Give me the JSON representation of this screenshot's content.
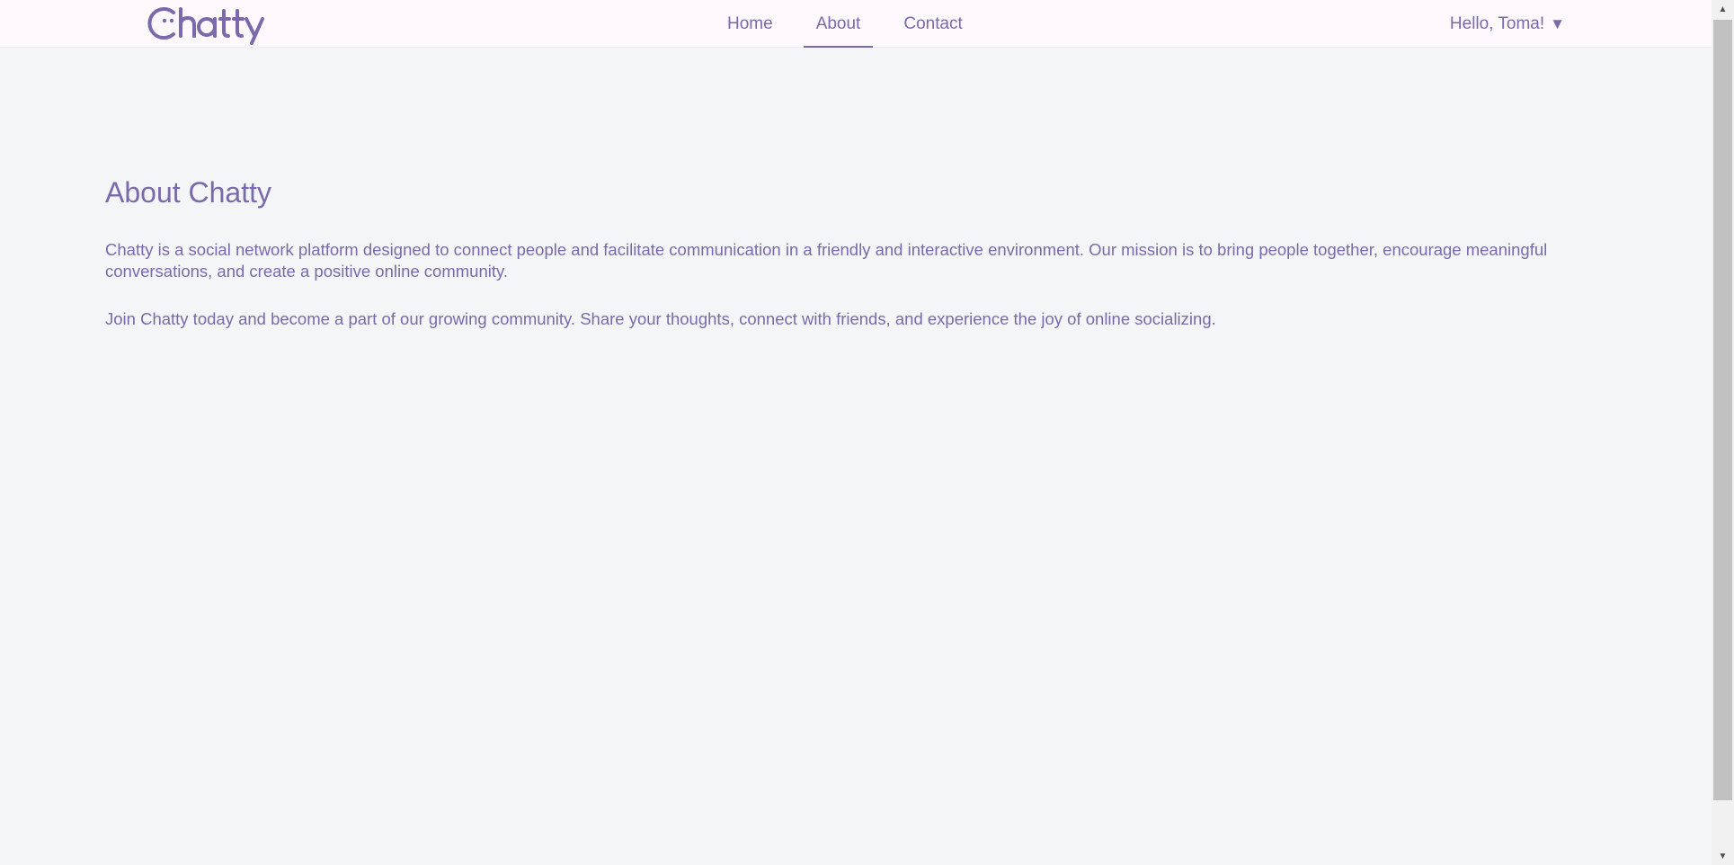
{
  "brand": {
    "name": "Chatty",
    "color": "#7a6aab"
  },
  "nav": {
    "links": [
      {
        "label": "Home",
        "active": false
      },
      {
        "label": "About",
        "active": true
      },
      {
        "label": "Contact",
        "active": false
      }
    ],
    "user_greeting": "Hello, Toma!",
    "user_caret": "▼"
  },
  "about": {
    "title": "About Chatty",
    "paragraphs": [
      "Chatty is a social network platform designed to connect people and facilitate communication in a friendly and interactive environment. Our mission is to bring people together, encourage meaningful conversations, and create a positive online community.",
      "Join Chatty today and become a part of our growing community. Share your thoughts, connect with friends, and experience the joy of online socializing."
    ]
  },
  "colors": {
    "accent": "#7a6aab",
    "header_bg": "#fdf8fc",
    "page_bg": "#f4f5f7"
  },
  "icons": {
    "logo": "chatty-smiley-logo",
    "user_dropdown": "caret-down-icon",
    "scroll_up": "scroll-up-arrow-icon",
    "scroll_down": "scroll-down-arrow-icon"
  }
}
